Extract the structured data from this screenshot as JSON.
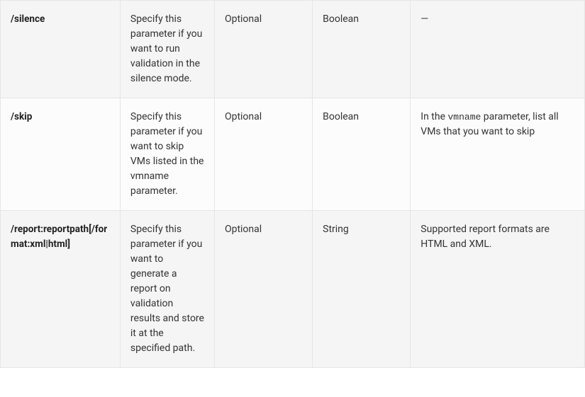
{
  "rows": [
    {
      "param": "/silence",
      "description": "Specify this parameter if you want to run validation in the silence mode.",
      "required": "Optional",
      "type": "Boolean",
      "info_prefix": "—",
      "info_code": "",
      "info_suffix": ""
    },
    {
      "param": "/skip",
      "description": "Specify this parameter if you want to skip VMs listed in the vmname parameter.",
      "required": "Optional",
      "type": "Boolean",
      "info_prefix": "In the ",
      "info_code": "vmname",
      "info_suffix": " parameter, list all VMs that you want to skip"
    },
    {
      "param": "/report:reportpath[/format:xml|html]",
      "description": "Specify this parameter if you want to generate a report on validation results and store it at the specified path.",
      "required": "Optional",
      "type": "String",
      "info_prefix": "Supported report formats are HTML and XML.",
      "info_code": "",
      "info_suffix": ""
    }
  ]
}
